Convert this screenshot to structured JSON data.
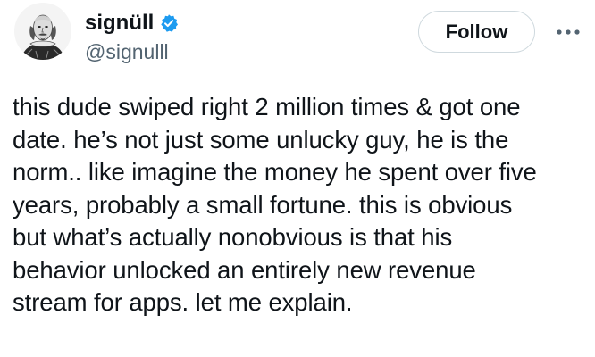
{
  "author": {
    "display_name": "signüll",
    "handle": "@signulll",
    "verified": true,
    "avatar_icon": "shakespeare-portrait-avatar",
    "verified_icon": "verified-badge-icon",
    "verified_color": "#1d9bf0"
  },
  "actions": {
    "follow_label": "Follow",
    "more_icon": "more-options-icon"
  },
  "tweet": {
    "lines": [
      "this dude swiped right 2 million times & got one",
      "date. he’s not just some unlucky guy, he is the",
      "norm.. like imagine the money he spent over five",
      "years, probably a small fortune. this is obvious",
      "but what’s actually nonobvious is that his",
      "behavior unlocked an entirely new revenue",
      "stream for apps. let me explain."
    ]
  }
}
